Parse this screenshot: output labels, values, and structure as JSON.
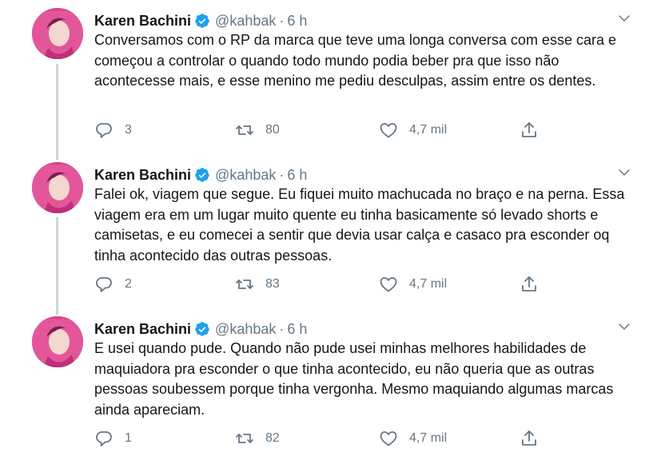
{
  "tweets": [
    {
      "author": "Karen Bachini",
      "handle": "@kahbak",
      "separator": "·",
      "time": "6 h",
      "text": "Conversamos com o RP da marca que teve uma longa conversa com esse cara e começou a controlar o quando todo mundo podia beber pra que isso não acontecesse mais, e esse menino me pediu desculpas, assim entre os dentes.",
      "replies": "3",
      "retweets": "80",
      "likes": "4,7 mil"
    },
    {
      "author": "Karen Bachini",
      "handle": "@kahbak",
      "separator": "·",
      "time": "6 h",
      "text": "Falei ok, viagem que segue. Eu fiquei muito machucada no braço e na perna. Essa viagem era em um lugar muito quente eu tinha basicamente só levado shorts e camisetas, e eu comecei a sentir que devia usar calça e casaco pra esconder oq tinha acontecido das outras pessoas.",
      "replies": "2",
      "retweets": "83",
      "likes": "4,7 mil"
    },
    {
      "author": "Karen Bachini",
      "handle": "@kahbak",
      "separator": "·",
      "time": "6 h",
      "text": "E usei quando pude. Quando não pude usei minhas melhores habilidades de maquiadora pra esconder o que tinha acontecido, eu não queria que as outras pessoas soubessem porque tinha vergonha. Mesmo maquiando algumas marcas ainda apareciam.",
      "replies": "1",
      "retweets": "82",
      "likes": "4,7 mil"
    }
  ],
  "icons": {
    "verified": "verified-badge-icon",
    "caret": "chevron-down-icon",
    "reply": "reply-icon",
    "retweet": "retweet-icon",
    "like": "heart-icon",
    "share": "share-icon"
  },
  "colors": {
    "text": "#14171a",
    "secondary": "#657786",
    "verified": "#1da1f2",
    "thread_line": "#ccd6dd"
  }
}
